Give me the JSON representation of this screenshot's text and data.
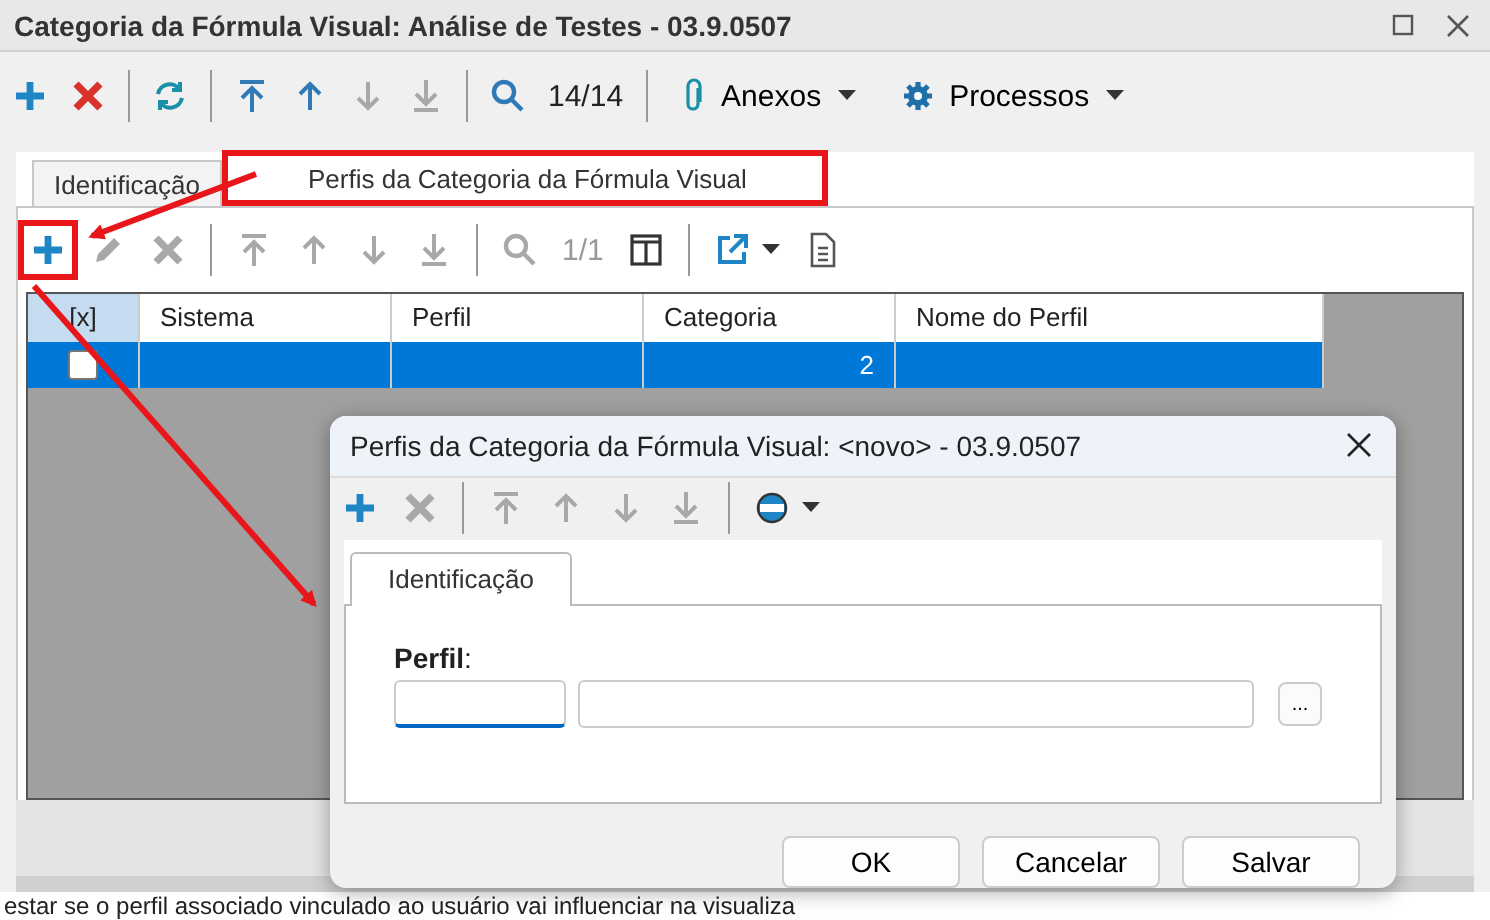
{
  "window": {
    "title": "Categoria da Fórmula Visual: Análise de Testes - 03.9.0507",
    "toolbar": [
      {
        "kind": "add",
        "disabled": false
      },
      {
        "kind": "delete",
        "disabled": false
      },
      {
        "kind": "separator"
      },
      {
        "kind": "refresh",
        "disabled": false
      },
      {
        "kind": "separator"
      },
      {
        "kind": "first",
        "disabled": false
      },
      {
        "kind": "up",
        "disabled": false
      },
      {
        "kind": "down",
        "disabled": true
      },
      {
        "kind": "last",
        "disabled": true
      },
      {
        "kind": "separator"
      },
      {
        "kind": "search",
        "disabled": false
      },
      {
        "kind": "counter",
        "text": "14/14"
      },
      {
        "kind": "separator"
      },
      {
        "kind": "attach",
        "text": "Anexos"
      },
      {
        "kind": "gear",
        "text": "Processos"
      }
    ]
  },
  "tabs": [
    {
      "label": "Identificação",
      "selected": false,
      "highlighted": false
    },
    {
      "label": "Perfis da Categoria da Fórmula Visual",
      "selected": true,
      "highlighted": true
    }
  ],
  "grid_toolbar": [
    {
      "kind": "add",
      "disabled": false,
      "highlighted": true
    },
    {
      "kind": "edit",
      "disabled": true,
      "highlighted": false
    },
    {
      "kind": "delete",
      "disabled": true,
      "highlighted": false
    },
    {
      "kind": "separator"
    },
    {
      "kind": "first",
      "disabled": true,
      "highlighted": false
    },
    {
      "kind": "up",
      "disabled": true,
      "highlighted": false
    },
    {
      "kind": "down",
      "disabled": true,
      "highlighted": false
    },
    {
      "kind": "last",
      "disabled": true,
      "highlighted": false
    },
    {
      "kind": "separator"
    },
    {
      "kind": "search",
      "disabled": true,
      "highlighted": false
    },
    {
      "kind": "counter",
      "text": "1/1",
      "disabled": true
    },
    {
      "kind": "columns",
      "disabled": false,
      "highlighted": false
    },
    {
      "kind": "separator"
    },
    {
      "kind": "export",
      "disabled": false,
      "highlighted": false
    },
    {
      "kind": "caret"
    },
    {
      "kind": "document",
      "disabled": false,
      "highlighted": false
    }
  ],
  "grid": {
    "columns": [
      "[x]",
      "Sistema",
      "Perfil",
      "Categoria",
      "Nome do Perfil"
    ],
    "rows": [
      {
        "checked": false,
        "selected": true,
        "cells": [
          "",
          "",
          "2",
          ""
        ]
      }
    ]
  },
  "dialog": {
    "title": "Perfis da Categoria da Fórmula Visual: <novo> - 03.9.0507",
    "toolbar": [
      {
        "kind": "add",
        "disabled": false
      },
      {
        "kind": "delete",
        "disabled": true
      },
      {
        "kind": "separator"
      },
      {
        "kind": "first",
        "disabled": true
      },
      {
        "kind": "up",
        "disabled": true
      },
      {
        "kind": "down",
        "disabled": true
      },
      {
        "kind": "last",
        "disabled": true
      },
      {
        "kind": "separator"
      },
      {
        "kind": "record",
        "disabled": false
      },
      {
        "kind": "caret"
      }
    ],
    "tabs": [
      {
        "label": "Identificação",
        "selected": true
      }
    ],
    "field_label": "**Perfil**:",
    "lookup_button": "...",
    "buttons": [
      "OK",
      "Cancelar",
      "Salvar"
    ]
  },
  "footer_text": "estar se o perfil associado vinculado ao usuário vai influenciar na visualiza"
}
